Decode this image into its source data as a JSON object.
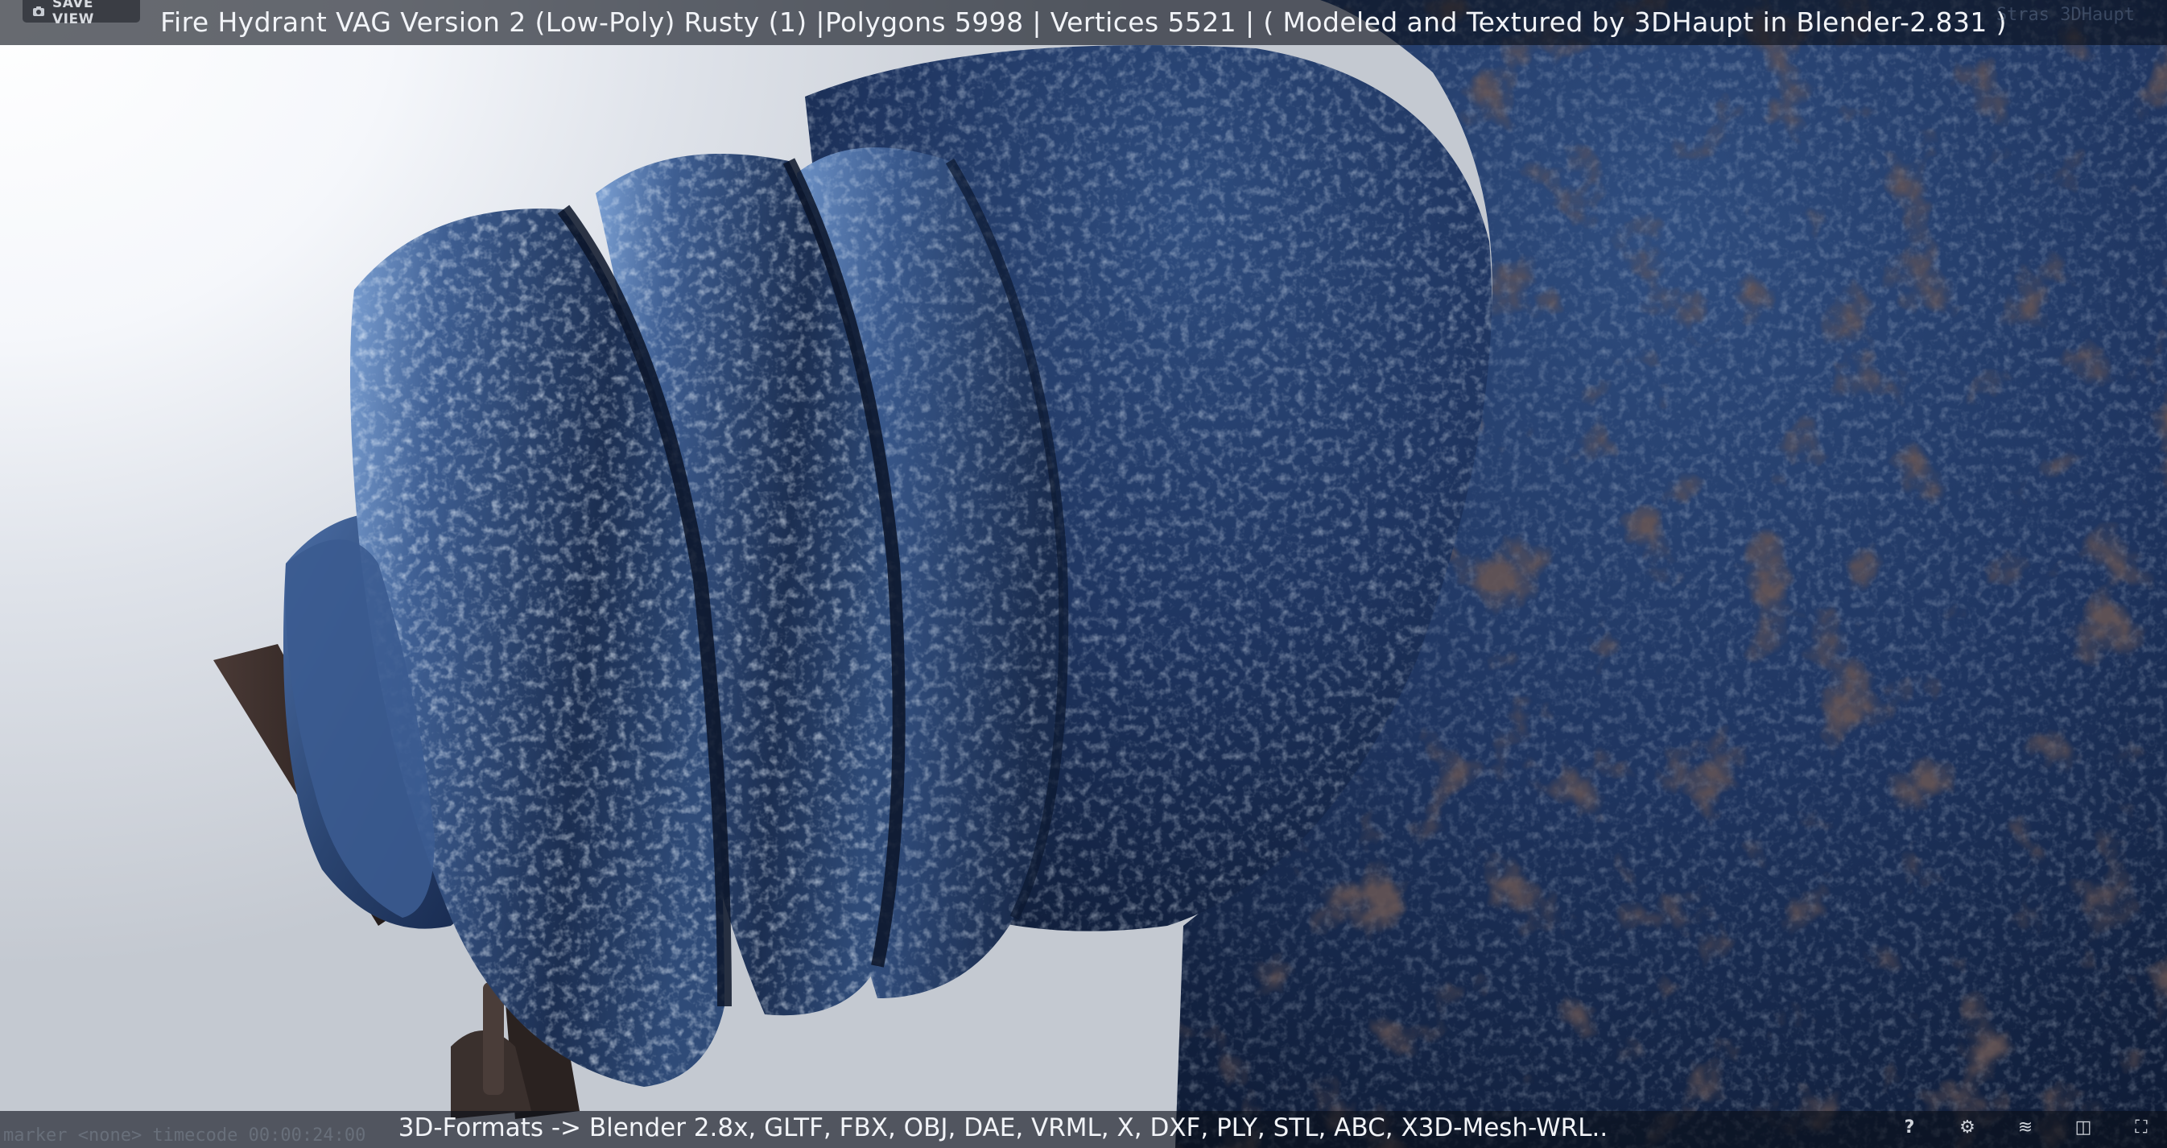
{
  "viewer": {
    "title": "Fire Hydrant VAG Version 2 (Low-Poly) Rusty (1) |Polygons 5998 | Vertices 5521 | ( Modeled and Textured by 3DHaupt in Blender-2.831 )",
    "formats": "3D-Formats -> Blender 2.8x, GLTF, FBX, OBJ, DAE, VRML, X, DXF, PLY, STL, ABC, X3D-Mesh-WRL..",
    "save_view_label": "SAVE VIEW",
    "top_right_ghost": "Stras 3DHaupt",
    "marker_ghost": "marker <none>   timecode 00:00:24:00"
  },
  "controls": [
    {
      "name": "help-icon",
      "glyph": "?"
    },
    {
      "name": "settings-icon",
      "glyph": "⚙"
    },
    {
      "name": "layers-icon",
      "glyph": "≋"
    },
    {
      "name": "vr-icon",
      "glyph": "◫"
    },
    {
      "name": "fullscreen-icon",
      "glyph": "⛶"
    }
  ],
  "colors": {
    "hydrant_blue": "#2d4a78",
    "hydrant_dark": "#0f1d33",
    "highlight": "#9fc2ef",
    "rust": "#2a1e1c",
    "background": "#eef1f6",
    "bar": "#0a0e18"
  }
}
